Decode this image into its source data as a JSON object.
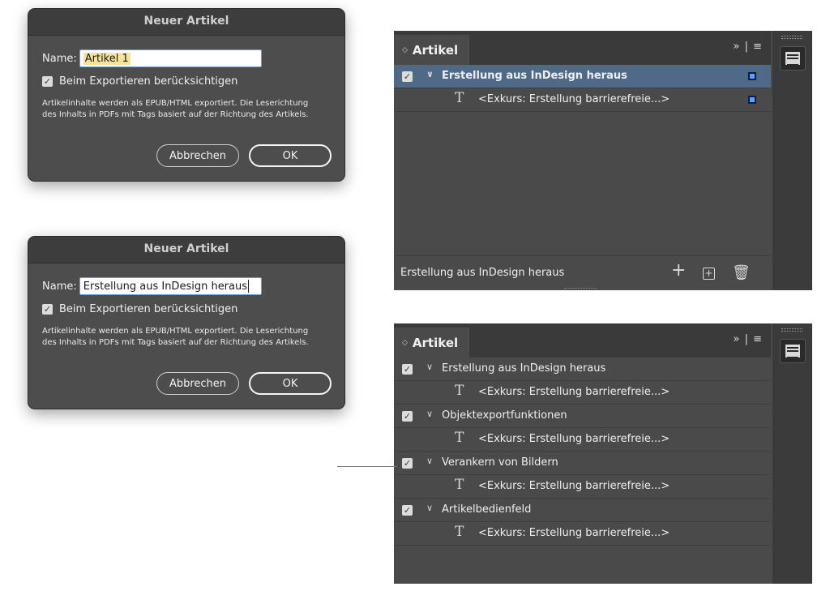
{
  "dialogs": [
    {
      "title": "Neuer Artikel",
      "name_label": "Name:",
      "name_value": "Artikel 1",
      "checkbox_label": "Beim Exportieren berücksichtigen",
      "info_text": "Artikelinhalte werden als EPUB/HTML exportiert. Die Leserichtung des Inhalts in PDFs mit Tags basiert auf der Richtung des Artikels.",
      "cancel_label": "Abbrechen",
      "ok_label": "OK"
    },
    {
      "title": "Neuer Artikel",
      "name_label": "Name:",
      "name_value": "Erstellung aus InDesign heraus",
      "checkbox_label": "Beim Exportieren berücksichtigen",
      "info_text": "Artikelinhalte werden als EPUB/HTML exportiert. Die Leserichtung des Inhalts in PDFs mit Tags basiert auf der Richtung des Artikels.",
      "cancel_label": "Abbrechen",
      "ok_label": "OK"
    }
  ],
  "panel1": {
    "tab": "Artikel",
    "menu": "»  |  ≡",
    "articles": [
      {
        "name": "Erstellung aus InDesign heraus",
        "story": "<Exkurs: Erstellung barrierefreie...>"
      }
    ],
    "footer_label": "Erstellung aus InDesign heraus"
  },
  "panel2": {
    "tab": "Artikel",
    "menu": "»  |  ≡",
    "articles": [
      {
        "name": "Erstellung aus InDesign heraus",
        "story": "<Exkurs: Erstellung barrierefreie...>"
      },
      {
        "name": "Objektexportfunktionen",
        "story": "<Exkurs: Erstellung barrierefreie...>"
      },
      {
        "name": "Verankern von Bildern",
        "story": "<Exkurs: Erstellung barrierefreie...>"
      },
      {
        "name": "Artikelbedienfeld",
        "story": "<Exkurs: Erstellung barrierefreie...>"
      }
    ]
  },
  "colors": {
    "dialog_bg": "#4d4d4d",
    "panel_bg": "#4a4a4a",
    "selection": "#4e6a87",
    "input_highlight": "#f6e39a"
  }
}
